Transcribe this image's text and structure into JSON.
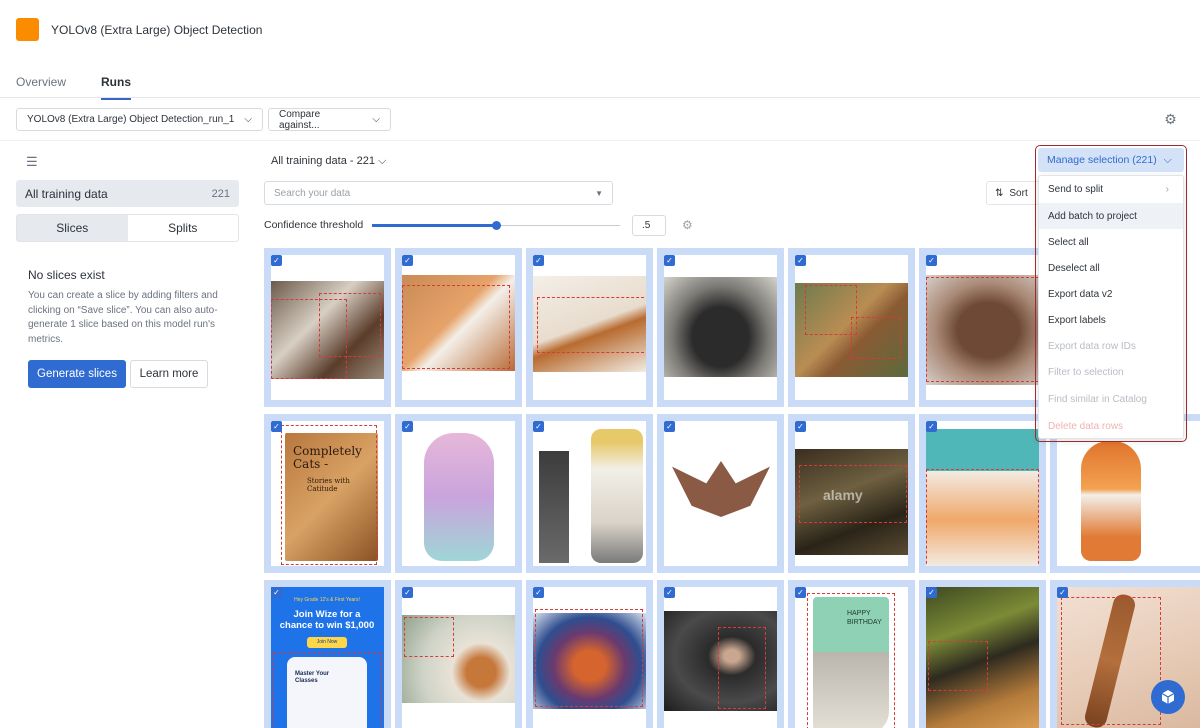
{
  "header": {
    "title": "YOLOv8 (Extra Large) Object Detection",
    "brand_color": "#fb8c00",
    "tabs": [
      {
        "label": "Overview"
      },
      {
        "label": "Runs"
      }
    ],
    "run_select": "YOLOv8 (Extra Large) Object Detection_run_1",
    "compare_select": "Compare against..."
  },
  "sidebar": {
    "all_data_label": "All training data",
    "all_data_count": "221",
    "seg_slices": "Slices",
    "seg_splits": "Splits",
    "empty_title": "No slices exist",
    "empty_desc": "You can create a slice by adding filters and clicking on “Save slice”. You can also auto-generate 1 slice based on this model run's metrics.",
    "generate_label": "Generate slices",
    "learn_label": "Learn more"
  },
  "main": {
    "data_label": "All training data - 221",
    "search_placeholder": "Search your data",
    "confidence_label": "Confidence threshold",
    "confidence_value": ".5",
    "confidence_fraction": 0.5,
    "sort_label": "Sort"
  },
  "menu": {
    "button_label": "Manage selection (221)",
    "items": [
      {
        "label": "Send to split",
        "disabled": false
      },
      {
        "label": "Add batch to project",
        "disabled": false
      },
      {
        "label": "Select all",
        "disabled": false
      },
      {
        "label": "Deselect all",
        "disabled": false
      },
      {
        "label": "Export data v2",
        "disabled": false
      },
      {
        "label": "Export labels",
        "disabled": false
      },
      {
        "label": "Export data row IDs",
        "disabled": true
      },
      {
        "label": "Filter to selection",
        "disabled": true
      },
      {
        "label": "Find similar in Catalog",
        "disabled": true
      },
      {
        "label": "Delete data rows",
        "disabled": true
      }
    ]
  },
  "thumb_text": {
    "book_title": "Completely Cats -",
    "book_sub": "Stories with Catitude",
    "ad_top": "Hey Grade 12's & First Years!",
    "ad_headline": "Join Wize for a chance to win $1,000",
    "ad_button": "Join Now",
    "ad_card": "Master Your Classes",
    "sock_text": "HAPPY BIRTHDAY",
    "watermark": "alamy"
  },
  "colors": {
    "accent": "#2f6bd0",
    "selection": "#c9dbf7",
    "box": "#d83a3a"
  }
}
